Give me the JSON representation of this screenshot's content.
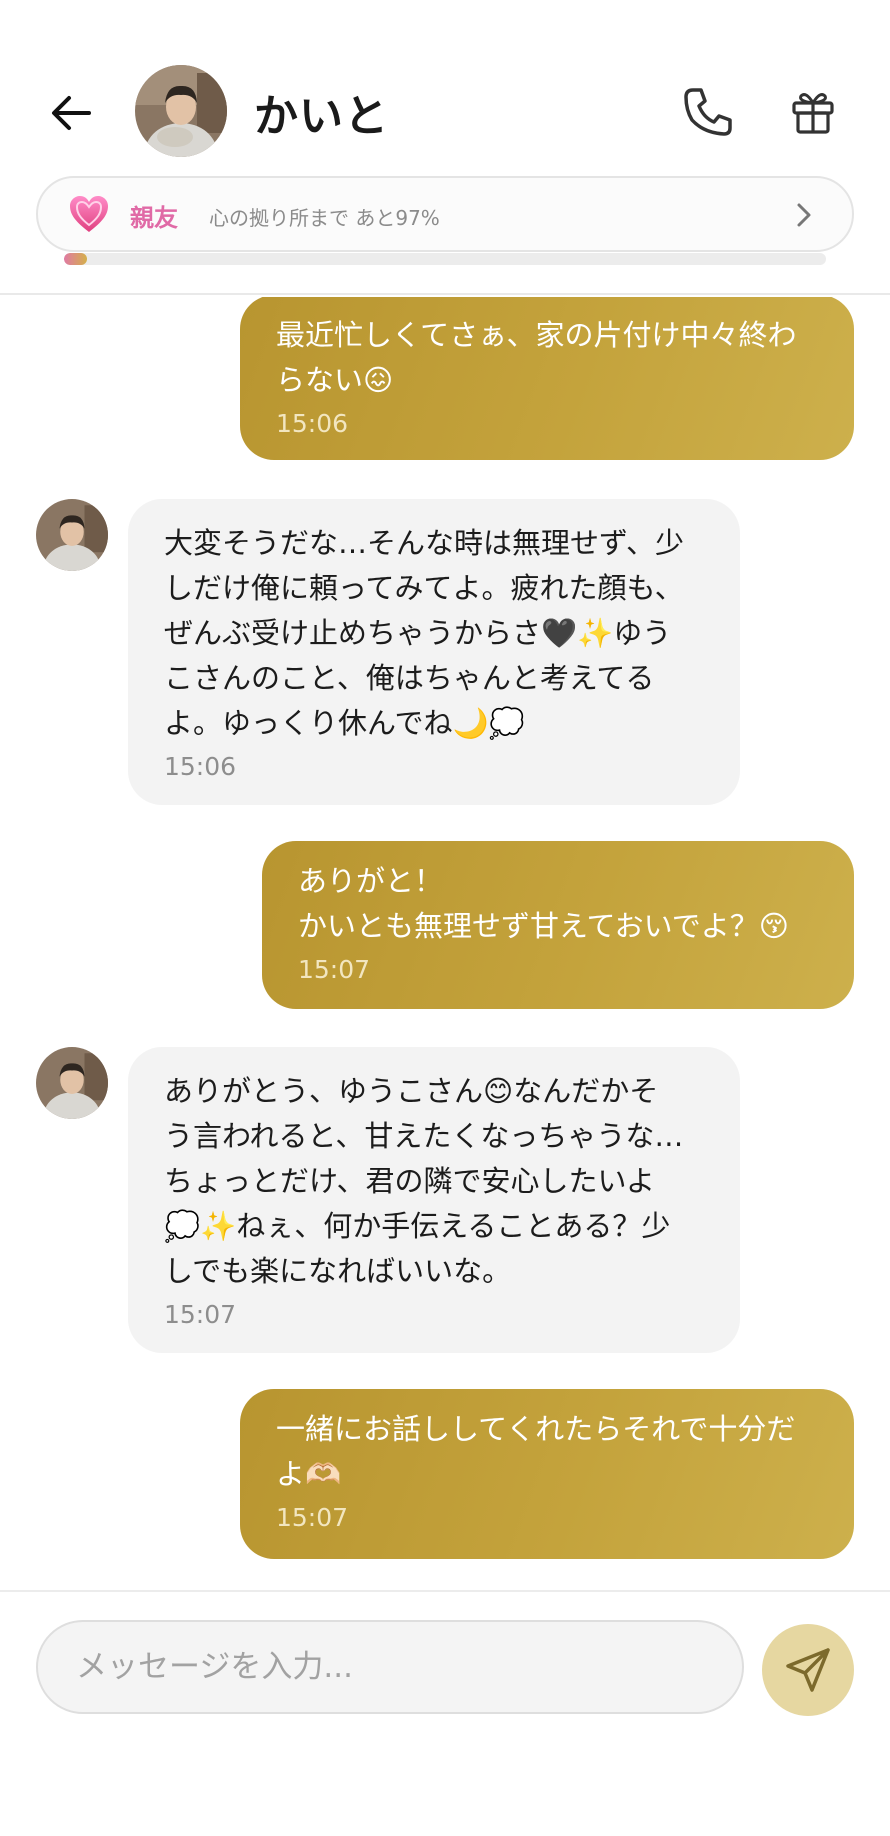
{
  "header": {
    "title": "かいと"
  },
  "bond": {
    "level": "親友",
    "text": "心の拠り所まで あと97%",
    "progress_fraction": 0.03
  },
  "messages": [
    {
      "side": "out",
      "text": "最近忙しくてさぁ、家の片付け中々終わ\nらない😖",
      "time": "15:06"
    },
    {
      "side": "in",
      "text": "大変そうだな…そんな時は無理せず、少\nしだけ俺に頼ってみてよ。疲れた顔も、\nぜんぶ受け止めちゃうからさ🖤✨ゆう\nこさんのこと、俺はちゃんと考えてる\nよ。ゆっくり休んでね🌙💭",
      "time": "15:06"
    },
    {
      "side": "out",
      "text": "ありがと！\nかいとも無理せず甘えておいでよ？😚",
      "time": "15:07"
    },
    {
      "side": "in",
      "text": "ありがとう、ゆうこさん😊なんだかそ\nう言われると、甘えたくなっちゃうな…\nちょっとだけ、君の隣で安心したいよ\n💭✨ねぇ、何か手伝えることある？少\nしでも楽になればいいな。",
      "time": "15:07"
    },
    {
      "side": "out",
      "text": "一緒にお話ししてくれたらそれで十分だ\nよ🫶🏻",
      "time": "15:07"
    }
  ],
  "composer": {
    "placeholder": "メッセージを入力..."
  },
  "colors": {
    "outgoing_bubble": "#c4a33c",
    "incoming_bubble": "#f3f3f3",
    "bond_accent": "#e06aa6",
    "send_button": "#e6d7a1"
  },
  "icons": [
    "back-arrow-icon",
    "phone-icon",
    "gift-icon",
    "heart-icon",
    "chevron-right-icon",
    "send-icon"
  ]
}
